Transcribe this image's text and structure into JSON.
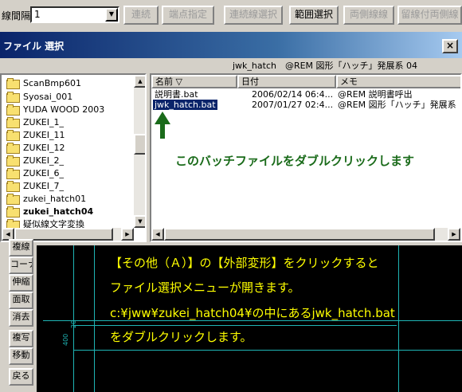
{
  "toolbar": {
    "label": "線間隔",
    "combo_value": "1",
    "buttons": [
      {
        "label": "連続",
        "enabled": false
      },
      {
        "label": "端点指定",
        "enabled": false
      },
      {
        "label": "連続線選択",
        "enabled": false
      },
      {
        "label": "範囲選択",
        "enabled": true
      },
      {
        "label": "両側線線",
        "enabled": false
      },
      {
        "label": "留線付両側線",
        "enabled": false
      }
    ]
  },
  "dialog": {
    "title": "ファイル 選択",
    "close": "×",
    "path": "jwk_hatch　@REM 図形「ハッチ」発展系 04"
  },
  "tree": {
    "items": [
      "ScanBmp601",
      "Syosai_001",
      "YUDA WOOD 2003",
      "ZUKEI_1_",
      "ZUKEI_11",
      "ZUKEI_12",
      "ZUKEI_2_",
      "ZUKEI_6_",
      "ZUKEI_7_",
      "zukei_hatch01",
      "zukei_hatch04",
      "疑似線文字変換"
    ],
    "selected_index": 10
  },
  "list": {
    "headers": [
      "名前 ▽",
      "日付",
      "メモ"
    ],
    "rows": [
      {
        "name": "説明書.bat",
        "date": "2006/02/14 06:4...",
        "memo": "@REM 説明書呼出"
      },
      {
        "name": "jwk_hatch.bat",
        "date": "2007/01/27 02:4...",
        "memo": "@REM 図形「ハッチ」発展系"
      }
    ],
    "selected_index": 1
  },
  "annotation": {
    "text": "このバッチファイルをダブルクリックします",
    "color": "#1a6b1a"
  },
  "cad_buttons": [
    "複線",
    "コーナー",
    "伸縮",
    "面取",
    "消去",
    "複写",
    "移動",
    "戻る"
  ],
  "instructions": {
    "lines": [
      "【その他（Ａ）】の【外部変形】をクリックすると",
      "ファイル選択メニューが開きます。",
      "c:¥jww¥zukei_hatch04¥の中にあるjwk_hatch.bat",
      "をダブルクリックします。"
    ],
    "color": "#ffff00"
  },
  "dims": [
    "20",
    "400"
  ]
}
